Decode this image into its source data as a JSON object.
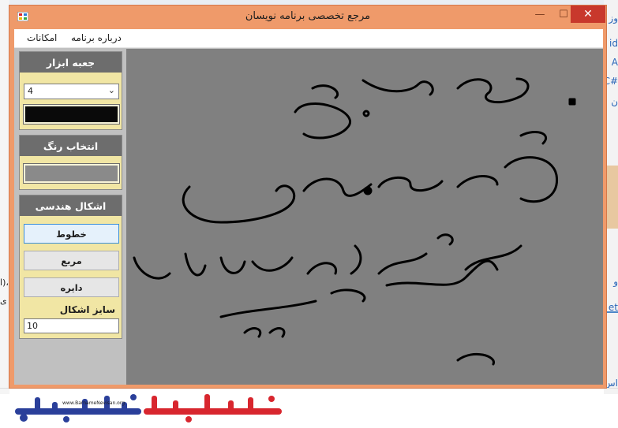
{
  "window": {
    "title": "مرجع تخصصی برنامه نویسان",
    "minimize_glyph": "—",
    "maximize_glyph": "☐",
    "close_glyph": "✕",
    "icon": "app-icon"
  },
  "menu": {
    "items": [
      {
        "label": "درباره برنامه"
      },
      {
        "label": "امکانات"
      }
    ]
  },
  "toolbox": {
    "header": "جعبه ابزار",
    "size_value": "4",
    "pen_color": "#0a0a0a"
  },
  "color_panel": {
    "header": "انتخاب رنگ",
    "fill_color": "#8a8a8a"
  },
  "shapes": {
    "header": "اشکال هندسی",
    "buttons": [
      {
        "label": "خطوط",
        "selected": true
      },
      {
        "label": "مربع",
        "selected": false
      },
      {
        "label": "دایره",
        "selected": false
      }
    ],
    "size_label": "سایز اشکال",
    "size_value": "10"
  },
  "canvas": {
    "background": "#808080",
    "stroke_color": "#000000"
  },
  "background_page": {
    "logo_url_text": "www.BarnameNevisan.org",
    "right_edge_fragments": [
      "وز",
      "id",
      "A",
      "C#",
      "ن",
      "و",
      "et",
      "اس"
    ],
    "left_edge_fragments": [
      "ا)،",
      "ی"
    ]
  },
  "colors": {
    "title_bar": "#ef9a6a",
    "close_button": "#c8382c",
    "panel_bg": "#f1e6a4",
    "panel_header": "#6d6d6d"
  }
}
